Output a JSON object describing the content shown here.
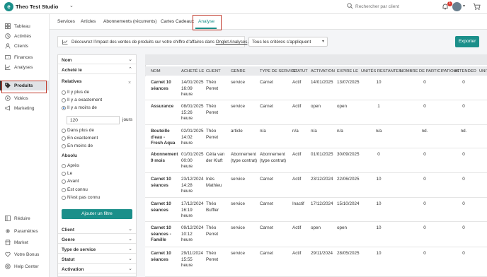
{
  "app": {
    "logo_letter": "e",
    "studio_name": "Theo Test Studio",
    "search_placeholder": "Rechercher par client",
    "notification_count": "1"
  },
  "colors": {
    "accent": "#1b8f8a",
    "highlight": "#c0392b"
  },
  "sidebar": {
    "items": [
      {
        "label": "Tableau",
        "icon": "dashboard-icon"
      },
      {
        "label": "Activités",
        "icon": "activity-icon"
      },
      {
        "label": "Clients",
        "icon": "user-icon"
      },
      {
        "label": "Finances",
        "icon": "wallet-icon"
      },
      {
        "label": "Analyses",
        "icon": "chart-icon"
      },
      {
        "label": "Produits",
        "icon": "tag-icon",
        "active": true
      },
      {
        "label": "Vidéos",
        "icon": "video-icon"
      },
      {
        "label": "Marketing",
        "icon": "megaphone-icon"
      }
    ],
    "bottom_items": [
      {
        "label": "Réduire",
        "icon": "collapse-icon"
      },
      {
        "label": "Paramètres",
        "icon": "gear-icon"
      },
      {
        "label": "Market",
        "icon": "store-icon"
      },
      {
        "label": "Votre Bonus",
        "icon": "heart-icon"
      },
      {
        "label": "Help Center",
        "icon": "help-icon"
      }
    ]
  },
  "tabs": [
    "Services",
    "Articles",
    "Abonnements (récurrents)",
    "Cartes Cadeaux",
    "Analyse"
  ],
  "info_bar": {
    "text_before": "Découvrez l'impact des ventes de produits sur votre chiffre d'affaires dans ",
    "link": "Onglet Analyses",
    "text_after": "."
  },
  "criteria_select": "Tous les critères s'appliquent",
  "export_label": "Exporter",
  "filters": {
    "nom": "Nom",
    "achete_le": "Acheté le",
    "relatives_label": "Relatives",
    "relative_options": [
      "Il y plus de",
      "Il y a exactement",
      "Il y a moins de"
    ],
    "days_value": "120",
    "days_unit": "jours",
    "future_options": [
      "Dans plus de",
      "En exactement",
      "En moins de"
    ],
    "absolu_label": "Absolu",
    "absolu_options": [
      "Après",
      "Le",
      "Avant",
      "Est connu",
      "N'est pas connu"
    ],
    "add_filter": "Ajouter un filtre",
    "collapsed": [
      "Client",
      "Genre",
      "Type de service",
      "Statut",
      "Activation"
    ]
  },
  "table": {
    "columns": [
      "NOM",
      "ACHETÉ LE",
      "CLIENT",
      "GENRE",
      "TYPE DE SERVICE",
      "STATUT",
      "ACTIVATION",
      "EXPIRE LE",
      "UNITÉS RESTANTES",
      "NOMBRE DE PARTICIPATIONS",
      "ATTENDED",
      "UNIT"
    ],
    "rows": [
      {
        "nom": "Carnet 10 séances",
        "achete": "14/01/2025 16:09 heure",
        "client": "Théo Perret",
        "genre": "service",
        "type": "Carnet",
        "statut": "Actif",
        "activation": "14/01/2025",
        "expire": "13/07/2025",
        "unites": "10",
        "participations": "0",
        "attended": "0"
      },
      {
        "nom": "Assurance",
        "achete": "08/01/2025 15:26 heure",
        "client": "Théo Perret",
        "genre": "service",
        "type": "Carnet",
        "statut": "Actif",
        "activation": "open",
        "expire": "open",
        "unites": "1",
        "participations": "0",
        "attended": "0"
      },
      {
        "nom": "Bouteille d'eau - Fresh Aqua",
        "achete": "02/01/2025 14:02 heure",
        "client": "Théo Perret",
        "genre": "article",
        "type": "n/a",
        "statut": "n/a",
        "activation": "n/a",
        "expire": "n/a",
        "unites": "n/a",
        "participations": "nd.",
        "attended": "nd."
      },
      {
        "nom": "Abonnement 9 mois",
        "achete": "01/01/2025 00:00 heure",
        "client": "Célia van der Kluft",
        "genre": "Abonnement (type contrat)",
        "type": "Abonnement (type contrat)",
        "statut": "Actif",
        "activation": "01/01/2025",
        "expire": "30/09/2025",
        "unites": "0",
        "participations": "0",
        "attended": "0"
      },
      {
        "nom": "Carnet 10 séances",
        "achete": "23/12/2024 14:28 heure",
        "client": "Inès Mathieu",
        "genre": "service",
        "type": "Carnet",
        "statut": "Actif",
        "activation": "23/12/2024",
        "expire": "22/06/2025",
        "unites": "10",
        "participations": "0",
        "attended": "0"
      },
      {
        "nom": "Carnet 10 séances",
        "achete": "17/12/2024 16:19 heure",
        "client": "Théo Buffler",
        "genre": "service",
        "type": "Carnet",
        "statut": "Inactif",
        "activation": "17/12/2024",
        "expire": "15/10/2024",
        "unites": "10",
        "participations": "0",
        "attended": "0"
      },
      {
        "nom": "Carnet 10 séances - Famille",
        "achete": "09/12/2024 10:12 heure",
        "client": "Théo Perret",
        "genre": "service",
        "type": "Carnet",
        "statut": "Actif",
        "activation": "open",
        "expire": "open",
        "unites": "10",
        "participations": "0",
        "attended": "0"
      },
      {
        "nom": "Carnet 10 séances",
        "achete": "29/11/2024 15:55 heure",
        "client": "Théo Perret",
        "genre": "service",
        "type": "Carnet",
        "statut": "Actif",
        "activation": "29/11/2024",
        "expire": "28/05/2025",
        "unites": "10",
        "participations": "0",
        "attended": "0"
      }
    ]
  }
}
